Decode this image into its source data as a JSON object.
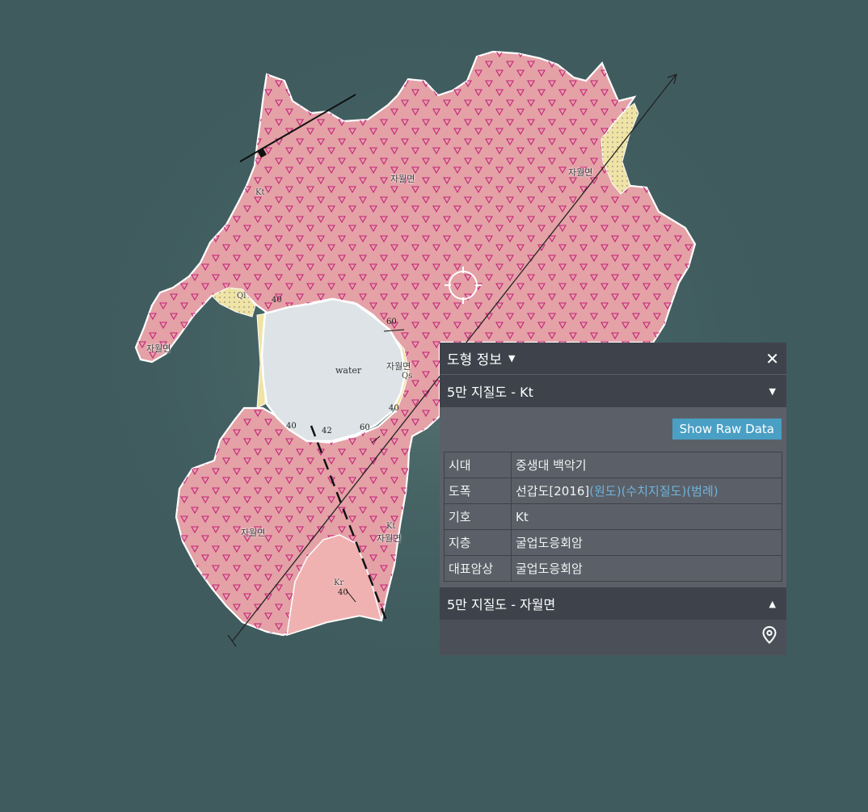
{
  "map": {
    "labels": {
      "top_center": "자월면",
      "top_right": "자월면",
      "left_arm": "자월면",
      "center_right": "자월면",
      "bottom_left": "자월면",
      "bottom_right": "자월면",
      "water": "water",
      "unit_kt_top": "Kt",
      "unit_kt_bottom": "Kt",
      "unit_kr": "Kr",
      "unit_ql": "Ql",
      "unit_qs": "Qs"
    },
    "dips": [
      "40",
      "60",
      "40",
      "42",
      "60",
      "40",
      "40"
    ],
    "colors": {
      "sea": "#3f5b5e",
      "formation_kt": "#e4a1a6",
      "formation_kr": "#f0b2b1",
      "formation_quaternary": "#efe3a6",
      "symbol": "#c4247a",
      "water": "#dde3e6"
    }
  },
  "panel": {
    "title": "도형 정보",
    "close_icon": "close-icon",
    "section1": {
      "title": "5만 지질도 - Kt",
      "raw_button": "Show Raw Data",
      "rows": {
        "era_key": "시대",
        "era_value": "중생대 백악기",
        "sheet_key": "도폭",
        "sheet_value": "선갑도[2016]",
        "sheet_link_original": "(원도)",
        "sheet_link_digital": "(수치지질도)",
        "sheet_link_legend": "(범례)",
        "symbol_key": "기호",
        "symbol_value": "Kt",
        "stratum_key": "지층",
        "stratum_value": "굴업도응회암",
        "rock_key": "대표암상",
        "rock_value": "굴업도응회암"
      }
    },
    "section2": {
      "title": "5만 지질도 - 자월면"
    }
  }
}
